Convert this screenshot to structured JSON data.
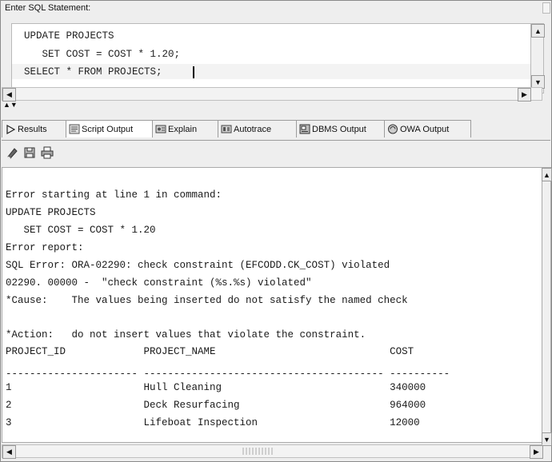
{
  "statement_label": "Enter SQL Statement:",
  "editor": {
    "lines": [
      "UPDATE PROJECTS",
      "   SET COST = COST * 1.20;",
      "SELECT * FROM PROJECTS;"
    ]
  },
  "tabs": [
    {
      "label": "Results",
      "icon": "play-icon",
      "active": false
    },
    {
      "label": "Script Output",
      "icon": "script-output-icon",
      "active": true
    },
    {
      "label": "Explain",
      "icon": "explain-icon",
      "active": false
    },
    {
      "label": "Autotrace",
      "icon": "autotrace-icon",
      "active": false
    },
    {
      "label": "DBMS Output",
      "icon": "dbms-output-icon",
      "active": false
    },
    {
      "label": "OWA Output",
      "icon": "owa-output-icon",
      "active": false
    }
  ],
  "toolbar": {
    "icons": [
      "eraser-icon",
      "save-icon",
      "print-icon"
    ]
  },
  "output": {
    "lines": [
      "",
      "Error starting at line 1 in command:",
      "UPDATE PROJECTS",
      "   SET COST = COST * 1.20",
      "Error report:",
      "SQL Error: ORA-02290: check constraint (EFCODD.CK_COST) violated",
      "02290. 00000 -  \"check constraint (%s.%s) violated\"",
      "*Cause:    The values being inserted do not satisfy the named check",
      "",
      "*Action:   do not insert values that violate the constraint.",
      "PROJECT_ID             PROJECT_NAME                             COST",
      "",
      "---------------------- ---------------------------------------- ----------",
      "1                      Hull Cleaning                            340000",
      "2                      Deck Resurfacing                         964000",
      "3                      Lifeboat Inspection                      12000"
    ]
  },
  "colors": {
    "window_bg": "#eeeeee",
    "pane_bg": "#ffffff",
    "border": "#9c9c9c"
  }
}
